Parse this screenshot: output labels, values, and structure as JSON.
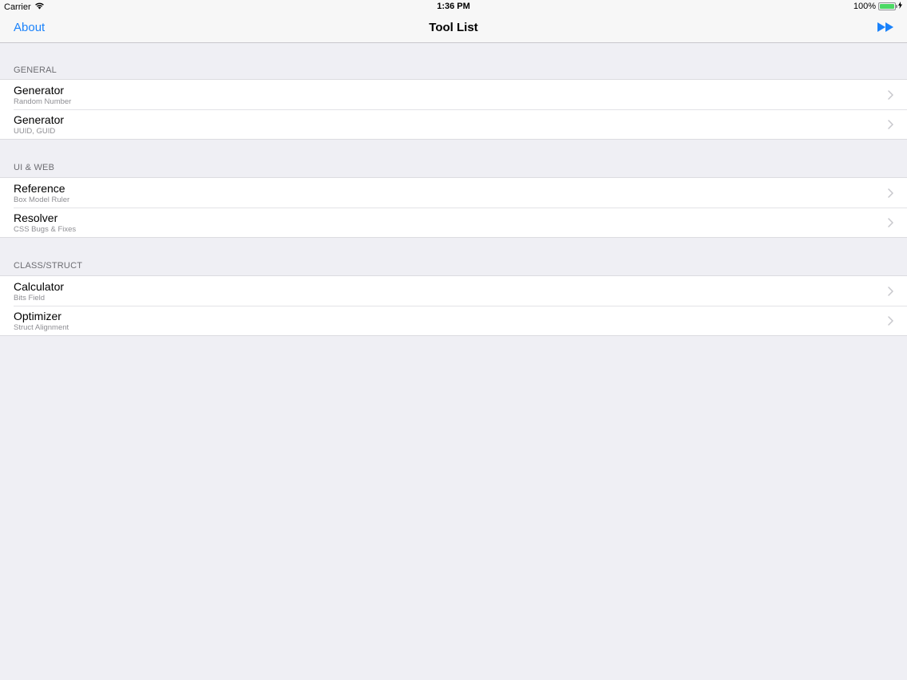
{
  "status": {
    "carrier": "Carrier",
    "time": "1:36 PM",
    "battery": "100%",
    "battery_level": 1.0
  },
  "nav": {
    "left_label": "About",
    "title": "Tool List",
    "right_icon": "fast-forward-icon"
  },
  "colors": {
    "accent": "#1a82fb",
    "background": "#efeff4",
    "battery": "#4cd964"
  },
  "sections": [
    {
      "header": "GENERAL",
      "rows": [
        {
          "title": "Generator",
          "subtitle": "Random Number"
        },
        {
          "title": "Generator",
          "subtitle": "UUID, GUID"
        }
      ]
    },
    {
      "header": "UI & WEB",
      "rows": [
        {
          "title": "Reference",
          "subtitle": "Box Model Ruler"
        },
        {
          "title": "Resolver",
          "subtitle": "CSS Bugs & Fixes"
        }
      ]
    },
    {
      "header": "CLASS/STRUCT",
      "rows": [
        {
          "title": "Calculator",
          "subtitle": "Bits Field"
        },
        {
          "title": "Optimizer",
          "subtitle": "Struct Alignment"
        }
      ]
    }
  ]
}
